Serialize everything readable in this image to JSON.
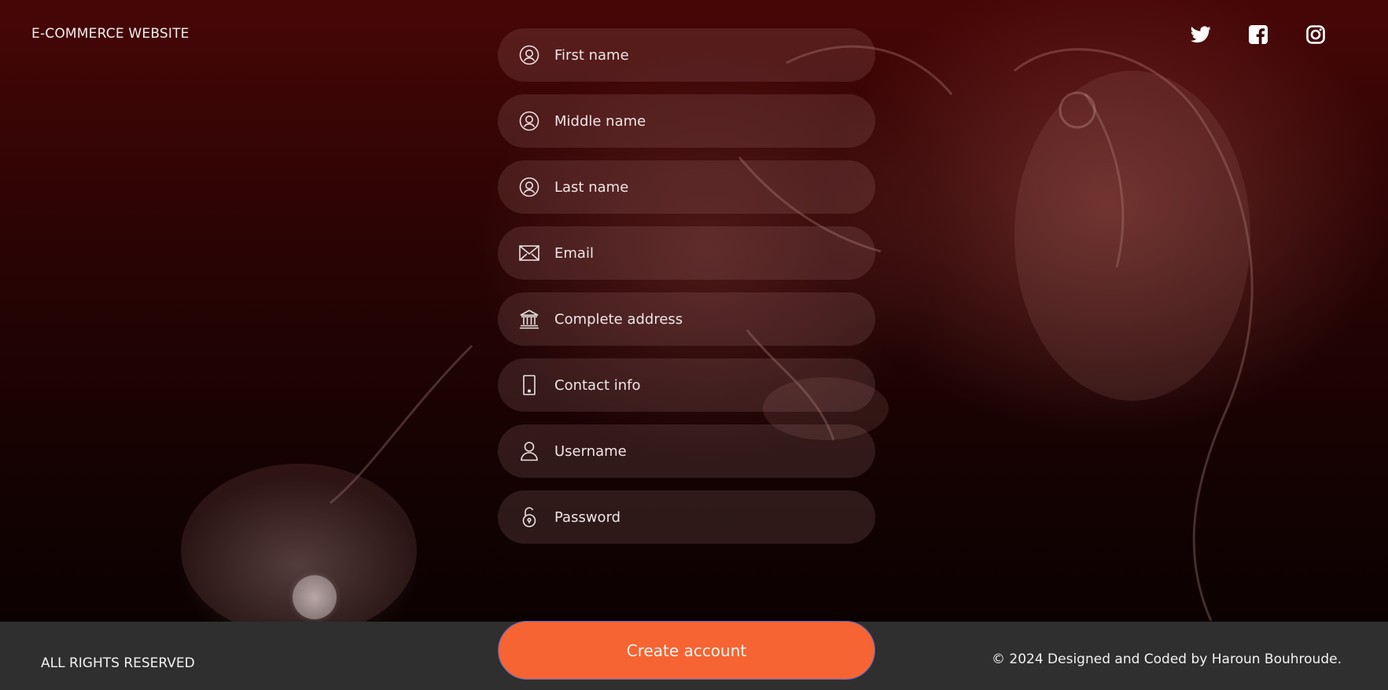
{
  "header": {
    "brand": "E-COMMERCE WEBSITE",
    "social": [
      {
        "name": "twitter-icon"
      },
      {
        "name": "facebook-icon"
      },
      {
        "name": "instagram-icon"
      }
    ]
  },
  "form": {
    "fields": [
      {
        "placeholder": "First name",
        "icon": "user-circle-icon",
        "value": ""
      },
      {
        "placeholder": "Middle name",
        "icon": "user-circle-icon",
        "value": ""
      },
      {
        "placeholder": "Last name",
        "icon": "user-circle-icon",
        "value": ""
      },
      {
        "placeholder": "Email",
        "icon": "envelope-icon",
        "value": ""
      },
      {
        "placeholder": "Complete address",
        "icon": "bank-icon",
        "value": ""
      },
      {
        "placeholder": "Contact info",
        "icon": "phone-icon",
        "value": ""
      },
      {
        "placeholder": "Username",
        "icon": "user-icon",
        "value": ""
      },
      {
        "placeholder": "Password",
        "icon": "lock-open-icon",
        "value": ""
      }
    ],
    "submit_label": "Create account"
  },
  "footer": {
    "rights": "ALL RIGHTS RESERVED",
    "credit": "© 2024 Designed and Coded by Haroun Bouhroude."
  },
  "colors": {
    "accent": "#f56432",
    "footer_bg": "#2f2f2f",
    "hero_top": "#470606"
  }
}
